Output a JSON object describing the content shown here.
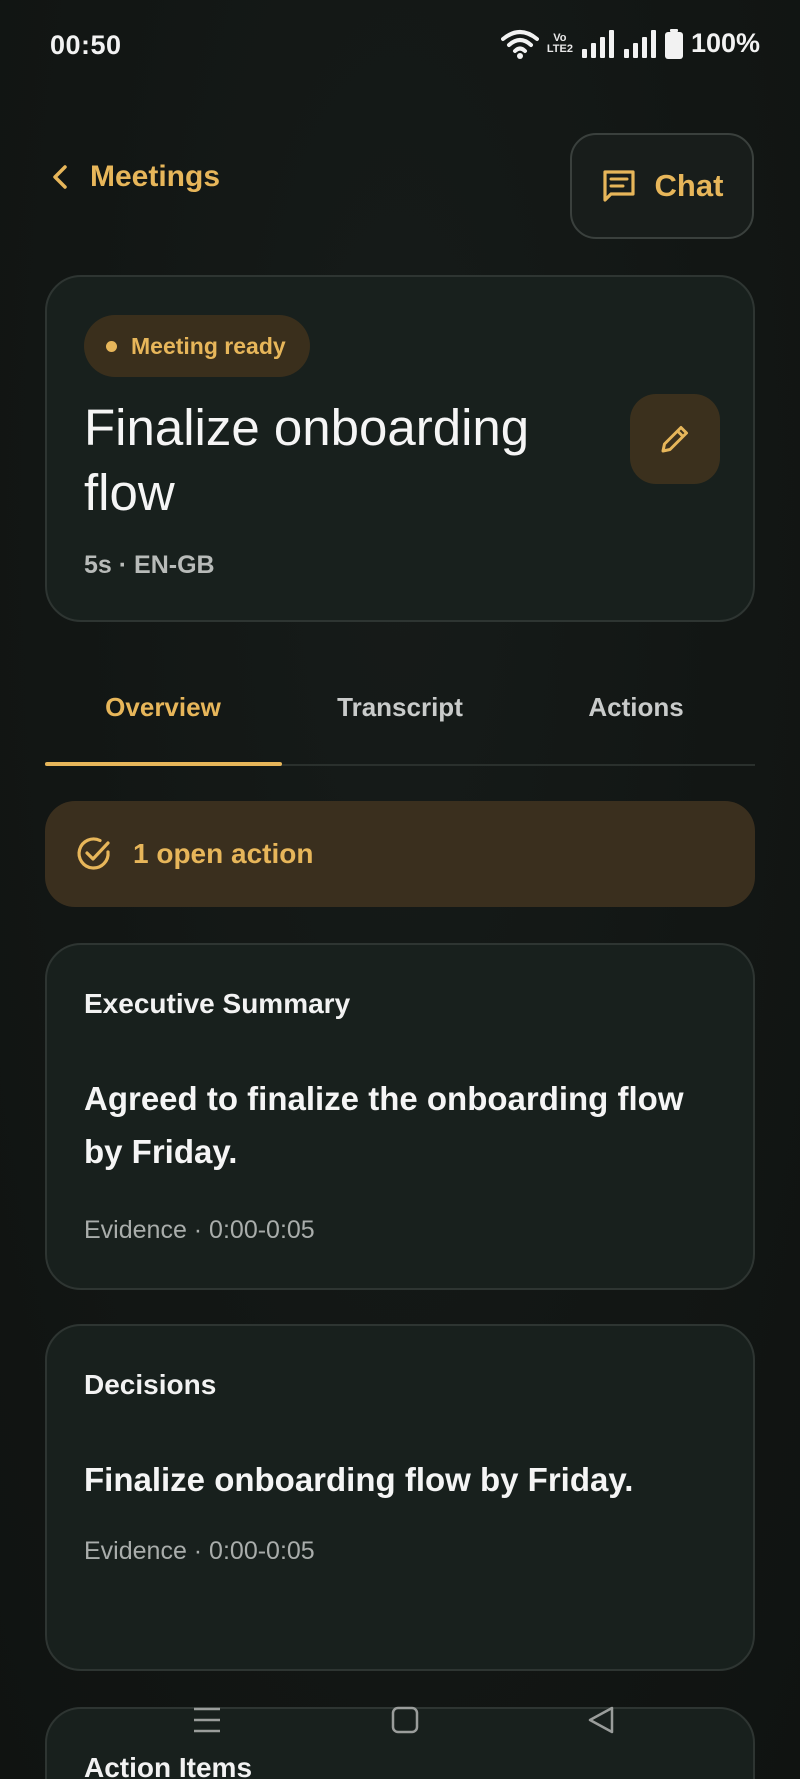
{
  "status_bar": {
    "time": "00:50",
    "volte_top": "Vo",
    "volte_bottom": "LTE2",
    "battery": "100%"
  },
  "header": {
    "back_label": "Meetings",
    "chat_label": "Chat"
  },
  "meeting": {
    "status": "Meeting ready",
    "title": "Finalize onboarding flow",
    "meta": "5s · EN-GB"
  },
  "tabs": [
    {
      "label": "Overview",
      "active": true
    },
    {
      "label": "Transcript",
      "active": false
    },
    {
      "label": "Actions",
      "active": false
    }
  ],
  "open_actions": {
    "label": "1 open action"
  },
  "summary": {
    "title": "Executive Summary",
    "text": "Agreed to finalize the onboarding flow by Friday.",
    "evidence": "Evidence · 0:00-0:05"
  },
  "decisions": {
    "title": "Decisions",
    "text": "Finalize onboarding flow by Friday.",
    "evidence": "Evidence · 0:00-0:05"
  },
  "action_items": {
    "title": "Action Items"
  },
  "colors": {
    "accent": "#e7b65a",
    "background": "#121614",
    "card": "#18201d",
    "accent_surface": "#3a2f1e"
  },
  "icons": {
    "back": "chevron-left-icon",
    "chat": "chat-bubble-icon",
    "edit": "pencil-icon",
    "open_action": "check-circle-icon",
    "nav_menu": "menu-icon",
    "nav_home": "square-home-icon",
    "nav_back": "triangle-back-icon"
  }
}
